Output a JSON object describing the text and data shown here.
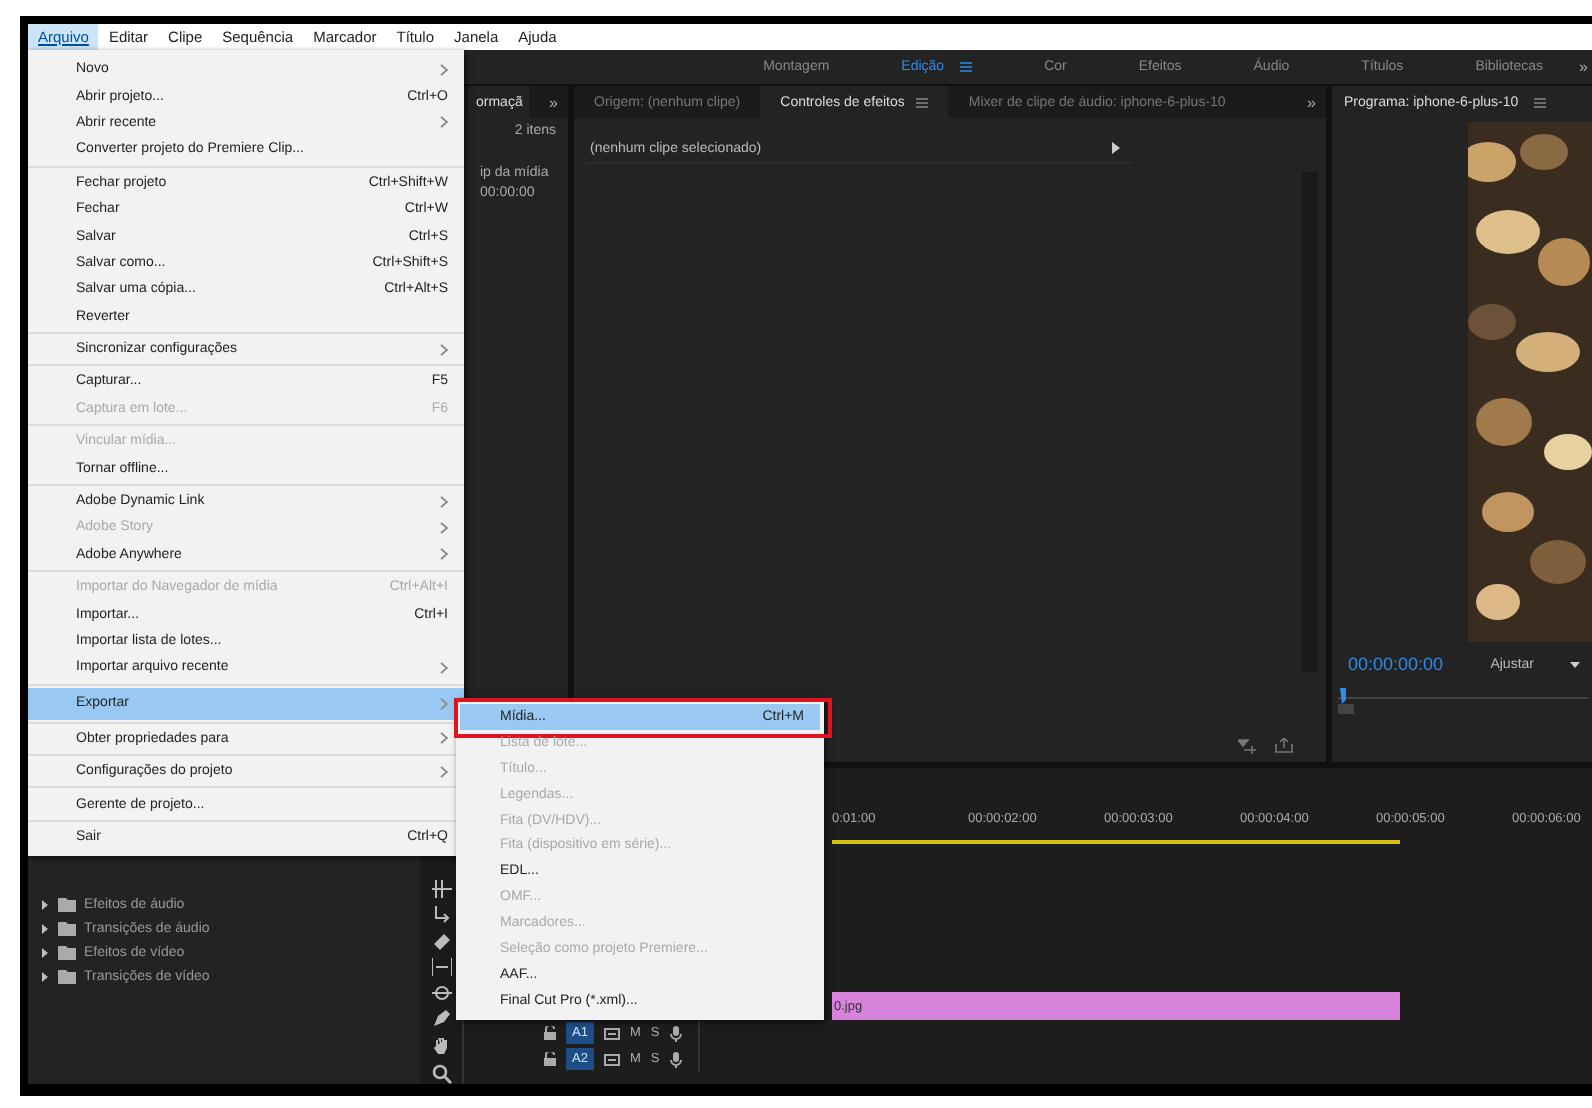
{
  "menubar": [
    {
      "label": "Arquivo",
      "selected": true
    },
    {
      "label": "Editar",
      "selected": false
    },
    {
      "label": "Clipe",
      "selected": false
    },
    {
      "label": "Sequência",
      "selected": false
    },
    {
      "label": "Marcador",
      "selected": false
    },
    {
      "label": "Título",
      "selected": false
    },
    {
      "label": "Janela",
      "selected": false
    },
    {
      "label": "Ajuda",
      "selected": false
    }
  ],
  "workspaces": {
    "items": [
      {
        "label": "Montagem",
        "selected": false
      },
      {
        "label": "Edição",
        "selected": true
      },
      {
        "label": "Cor",
        "selected": false
      },
      {
        "label": "Efeitos",
        "selected": false
      },
      {
        "label": "Áudio",
        "selected": false
      },
      {
        "label": "Títulos",
        "selected": false
      },
      {
        "label": "Bibliotecas",
        "selected": false
      }
    ],
    "more": "»"
  },
  "project_panel": {
    "tab": "ormaçã",
    "more": "»",
    "count": "2 itens",
    "column": "ip da mídia",
    "timecode": "00:00:00"
  },
  "source_panel": {
    "tabs": [
      {
        "label": "Origem: (nenhum clipe)",
        "selected": false
      },
      {
        "label": "Controles de efeitos",
        "selected": true
      },
      {
        "label": "Mixer de clipe de áudio: iphone-6-plus-10",
        "selected": false
      }
    ],
    "more": "»",
    "clip_row": "(nenhum clipe selecionado)"
  },
  "program_panel": {
    "title": "Programa: iphone-6-plus-10",
    "timecode": "00:00:00:00",
    "zoom": "Ajustar"
  },
  "effects_panel": {
    "items": [
      {
        "label": "Efeitos de áudio",
        "expanded": false
      },
      {
        "label": "Transições de áudio",
        "expanded": false
      },
      {
        "label": "Efeitos de vídeo",
        "expanded": false
      },
      {
        "label": "Transições de vídeo",
        "expanded": false
      }
    ]
  },
  "timeline": {
    "ticks": [
      "0:01:00",
      "00:00:02:00",
      "00:00:03:00",
      "00:00:04:00",
      "00:00:05:00",
      "00:00:06:00"
    ],
    "clip": "0.jpg",
    "tracks": [
      {
        "name": "A1",
        "selected": true,
        "mute": "M",
        "solo": "S"
      },
      {
        "name": "A2",
        "selected": true,
        "mute": "M",
        "solo": "S"
      }
    ]
  },
  "menu": {
    "groups": [
      [
        {
          "label": "Novo",
          "disabled": false,
          "arrow": true,
          "selected": false
        },
        {
          "label": "Abrir projeto...",
          "shortcut": "Ctrl+O",
          "disabled": false,
          "arrow": false,
          "selected": false
        },
        {
          "label": "Abrir recente",
          "disabled": false,
          "arrow": true,
          "selected": false
        },
        {
          "label": "Converter projeto do Premiere Clip...",
          "disabled": false,
          "arrow": false,
          "selected": false
        }
      ],
      [
        {
          "label": "Fechar projeto",
          "shortcut": "Ctrl+Shift+W",
          "disabled": false,
          "arrow": false,
          "selected": false
        },
        {
          "label": "Fechar",
          "shortcut": "Ctrl+W",
          "disabled": false,
          "arrow": false,
          "selected": false
        },
        {
          "label": "Salvar",
          "shortcut": "Ctrl+S",
          "disabled": false,
          "arrow": false,
          "selected": false
        },
        {
          "label": "Salvar como...",
          "shortcut": "Ctrl+Shift+S",
          "disabled": false,
          "arrow": false,
          "selected": false
        },
        {
          "label": "Salvar uma cópia...",
          "shortcut": "Ctrl+Alt+S",
          "disabled": false,
          "arrow": false,
          "selected": false
        },
        {
          "label": "Reverter",
          "disabled": false,
          "arrow": false,
          "selected": false
        }
      ],
      [
        {
          "label": "Sincronizar configurações",
          "disabled": false,
          "arrow": true,
          "selected": false
        }
      ],
      [
        {
          "label": "Capturar...",
          "shortcut": "F5",
          "disabled": false,
          "arrow": false,
          "selected": false
        },
        {
          "label": "Captura em lote...",
          "shortcut": "F6",
          "disabled": true,
          "arrow": false,
          "selected": false
        }
      ],
      [
        {
          "label": "Vincular mídia...",
          "disabled": true,
          "arrow": false,
          "selected": false
        },
        {
          "label": "Tornar offline...",
          "disabled": false,
          "arrow": false,
          "selected": false
        }
      ],
      [
        {
          "label": "Adobe Dynamic Link",
          "disabled": false,
          "arrow": true,
          "selected": false
        },
        {
          "label": "Adobe Story",
          "disabled": true,
          "arrow": true,
          "selected": false
        },
        {
          "label": "Adobe Anywhere",
          "disabled": false,
          "arrow": true,
          "selected": false
        }
      ],
      [
        {
          "label": "Importar do Navegador de mídia",
          "shortcut": "Ctrl+Alt+I",
          "disabled": true,
          "arrow": false,
          "selected": false
        },
        {
          "label": "Importar...",
          "shortcut": "Ctrl+I",
          "disabled": false,
          "arrow": false,
          "selected": false
        },
        {
          "label": "Importar lista de lotes...",
          "disabled": false,
          "arrow": false,
          "selected": false
        },
        {
          "label": "Importar arquivo recente",
          "disabled": false,
          "arrow": true,
          "selected": false
        }
      ],
      [
        {
          "label": "Exportar",
          "disabled": false,
          "arrow": true,
          "selected": true
        }
      ],
      [
        {
          "label": "Obter propriedades para",
          "disabled": false,
          "arrow": true,
          "selected": false
        }
      ],
      [
        {
          "label": "Configurações do projeto",
          "disabled": false,
          "arrow": true,
          "selected": false
        }
      ],
      [
        {
          "label": "Gerente de projeto...",
          "disabled": false,
          "arrow": false,
          "selected": false
        }
      ],
      [
        {
          "label": "Sair",
          "shortcut": "Ctrl+Q",
          "disabled": false,
          "arrow": false,
          "selected": false
        }
      ]
    ]
  },
  "submenu": {
    "items": [
      {
        "label": "Mídia...",
        "shortcut": "Ctrl+M",
        "disabled": false,
        "selected": true,
        "annotated": true
      },
      {
        "label": "Lista de lote...",
        "disabled": true,
        "selected": false,
        "annotated": false
      },
      {
        "label": "Título...",
        "disabled": true,
        "selected": false,
        "annotated": false
      },
      {
        "label": "Legendas...",
        "disabled": true,
        "selected": false,
        "annotated": false
      },
      {
        "label": "Fita (DV/HDV)...",
        "disabled": true,
        "selected": false,
        "annotated": false
      },
      {
        "label": "Fita (dispositivo em série)...",
        "disabled": true,
        "selected": false,
        "annotated": false
      },
      {
        "label": "EDL...",
        "disabled": false,
        "selected": false,
        "annotated": false
      },
      {
        "label": "OMF...",
        "disabled": true,
        "selected": false,
        "annotated": false
      },
      {
        "label": "Marcadores...",
        "disabled": true,
        "selected": false,
        "annotated": false
      },
      {
        "label": "Seleção como projeto Premiere...",
        "disabled": true,
        "selected": false,
        "annotated": false
      },
      {
        "label": "AAF...",
        "disabled": false,
        "selected": false,
        "annotated": false
      },
      {
        "label": "Final Cut Pro  (*.xml)...",
        "disabled": false,
        "selected": false,
        "annotated": false
      }
    ]
  }
}
